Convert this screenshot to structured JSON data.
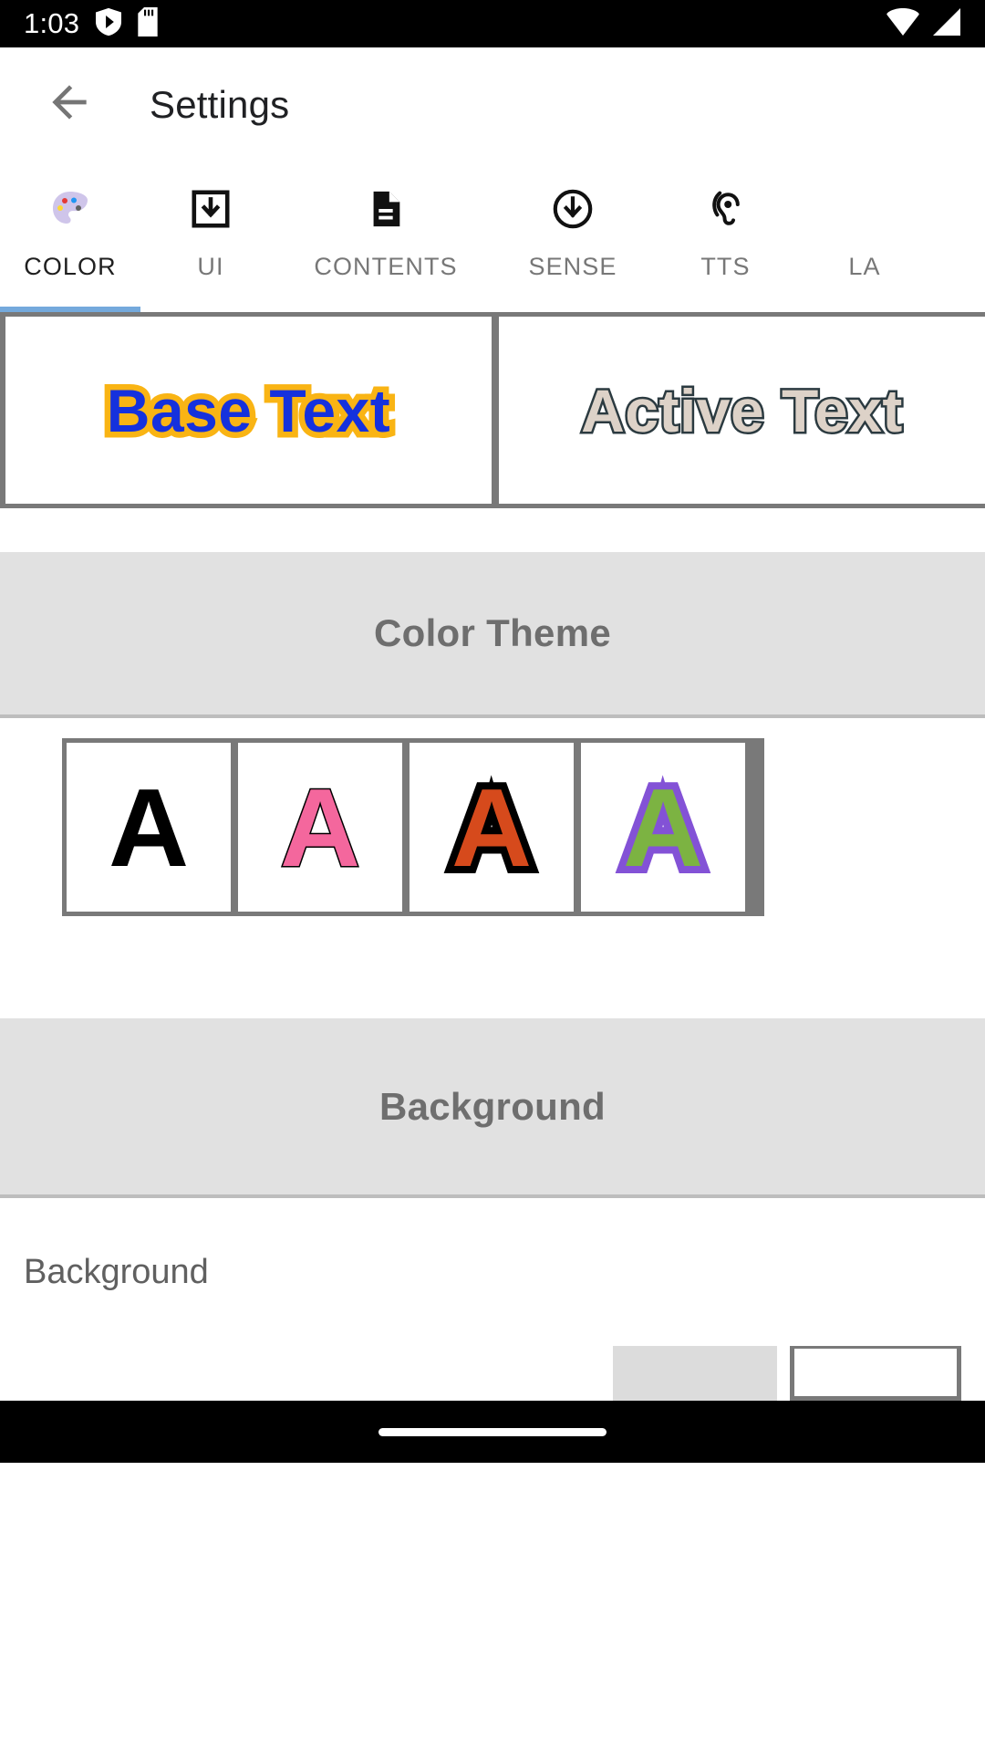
{
  "status_bar": {
    "clock": "1:03",
    "left_icons": [
      "play-protect-shield-icon",
      "sd-card-icon"
    ],
    "right_icons": [
      "wifi-icon",
      "cell-signal-icon"
    ]
  },
  "app_bar": {
    "back_icon": "back-arrow-icon",
    "title": "Settings"
  },
  "tabs": {
    "active_index": 0,
    "indicator_color": "#74a9dc",
    "items": [
      {
        "label": "COLOR",
        "icon": "palette-icon"
      },
      {
        "label": "UI",
        "icon": "download-box-icon"
      },
      {
        "label": "CONTENTS",
        "icon": "document-icon"
      },
      {
        "label": "SENSE",
        "icon": "circle-down-arrow-icon"
      },
      {
        "label": "TTS",
        "icon": "ear-hearing-icon"
      },
      {
        "label": "LA",
        "icon": "language-icon"
      }
    ]
  },
  "preview": {
    "base": {
      "label": "Base Text",
      "fill_color": "#1531dd",
      "outline_color": "#f9b414"
    },
    "active": {
      "label": "Active Text",
      "fill_color": "#ddd2c8",
      "outline_color": "#2b3a40"
    }
  },
  "color_theme_section": {
    "header": "Color Theme",
    "swatches": [
      {
        "letter": "A",
        "fill_color": "#000000",
        "outline_color": "#000000"
      },
      {
        "letter": "A",
        "fill_color": "#f4679d",
        "outline_color": "#000000"
      },
      {
        "letter": "A",
        "fill_color": "#d64a1c",
        "outline_color": "#000000"
      },
      {
        "letter": "A",
        "fill_color": "#7cb342",
        "outline_color": "#8352d6"
      }
    ]
  },
  "background_section": {
    "header": "Background",
    "row_label": "Background",
    "chip_grey_color": "#dcdcdc",
    "chip_white_color": "#ffffff"
  },
  "nav_bar": {
    "gesture_pill": "home-gesture-pill"
  }
}
